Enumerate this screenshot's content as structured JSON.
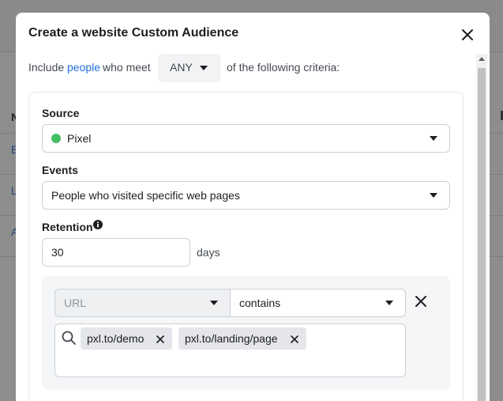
{
  "background": {
    "row_letters": [
      "N",
      "B",
      "L",
      "A"
    ]
  },
  "modal": {
    "title": "Create a website Custom Audience",
    "criteria": {
      "prefix": "Include",
      "link": "people",
      "middle": "who meet",
      "match_value": "ANY",
      "suffix": "of the following criteria:"
    },
    "source": {
      "label": "Source",
      "value": "Pixel",
      "status_color": "#45bd62"
    },
    "events": {
      "label": "Events",
      "value": "People who visited specific web pages"
    },
    "retention": {
      "label": "Retention",
      "value": "30",
      "unit": "days"
    },
    "rule": {
      "field": "URL",
      "operator": "contains",
      "values": [
        "pxl.to/demo",
        "pxl.to/landing/page"
      ]
    }
  },
  "colors": {
    "link": "#216fdb",
    "overlay": "#8d8d8d"
  }
}
